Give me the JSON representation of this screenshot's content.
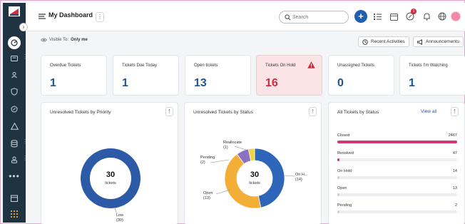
{
  "header": {
    "title": "My Dashboard",
    "search_placeholder": "Search",
    "add_label": "+",
    "notification_count": "1"
  },
  "sidebar": {
    "icons": [
      "dashboard-icon",
      "tickets-icon",
      "contacts-icon",
      "shield-icon",
      "reports-icon",
      "alerts-icon",
      "database-icon",
      "users-icon",
      "calendar-icon",
      "apps-icon"
    ]
  },
  "visibility": {
    "label": "Visible To:",
    "value": "Only me"
  },
  "actions": {
    "recent_activities": "Recent Activities",
    "announcements": "Announcements"
  },
  "kpis": [
    {
      "label": "Overdue Tickets",
      "value": "1"
    },
    {
      "label": "Tickets Due Today",
      "value": "1"
    },
    {
      "label": "Open tickets",
      "value": "13"
    },
    {
      "label": "Tickets On Hold",
      "value": "16"
    },
    {
      "label": "Unassigned Tickets",
      "value": "0"
    },
    {
      "label": "Tickets I'm Watching",
      "value": "1"
    }
  ],
  "panels": {
    "priority": {
      "title": "Unresolved Tickets by Priority",
      "center_value": "30",
      "center_label": "tickets",
      "low_label": "Low",
      "low_count": "(30)"
    },
    "status": {
      "title": "Unresolved Tickets by Status",
      "center_value": "30",
      "center_label": "tickets",
      "reallocate_label": "Reallocate",
      "reallocate_count": "(1)",
      "pending_label": "Pending",
      "pending_count": "(2)",
      "open_label": "Open",
      "open_count": "(13)",
      "onhold_label": "On H...",
      "onhold_count": "(14)"
    },
    "all_status": {
      "title": "All Tickets by Status",
      "view_all": "View all",
      "rows": [
        {
          "name": "Closed",
          "count": "2467"
        },
        {
          "name": "Resolved",
          "count": "47"
        },
        {
          "name": "On Hold",
          "count": "14"
        },
        {
          "name": "Open",
          "count": "13"
        },
        {
          "name": "Pending",
          "count": "2"
        }
      ]
    }
  },
  "chart_data": [
    {
      "type": "pie",
      "title": "Unresolved Tickets by Priority",
      "categories": [
        "Low"
      ],
      "values": [
        30
      ],
      "colors": [
        "#2d5aa6"
      ]
    },
    {
      "type": "pie",
      "title": "Unresolved Tickets by Status",
      "categories": [
        "On Hold",
        "Open",
        "Pending",
        "Reallocate"
      ],
      "values": [
        14,
        13,
        2,
        1
      ],
      "colors": [
        "#2d66b8",
        "#f3ae36",
        "#8a72c2",
        "#f0d43b"
      ]
    },
    {
      "type": "bar",
      "title": "All Tickets by Status",
      "categories": [
        "Closed",
        "Resolved",
        "On Hold",
        "Open",
        "Pending"
      ],
      "values": [
        2467,
        47,
        14,
        13,
        2
      ],
      "colors": [
        "#d23877",
        "#d23877",
        "#cfd3d8",
        "#cfd3d8",
        "#cfd3d8"
      ]
    }
  ]
}
